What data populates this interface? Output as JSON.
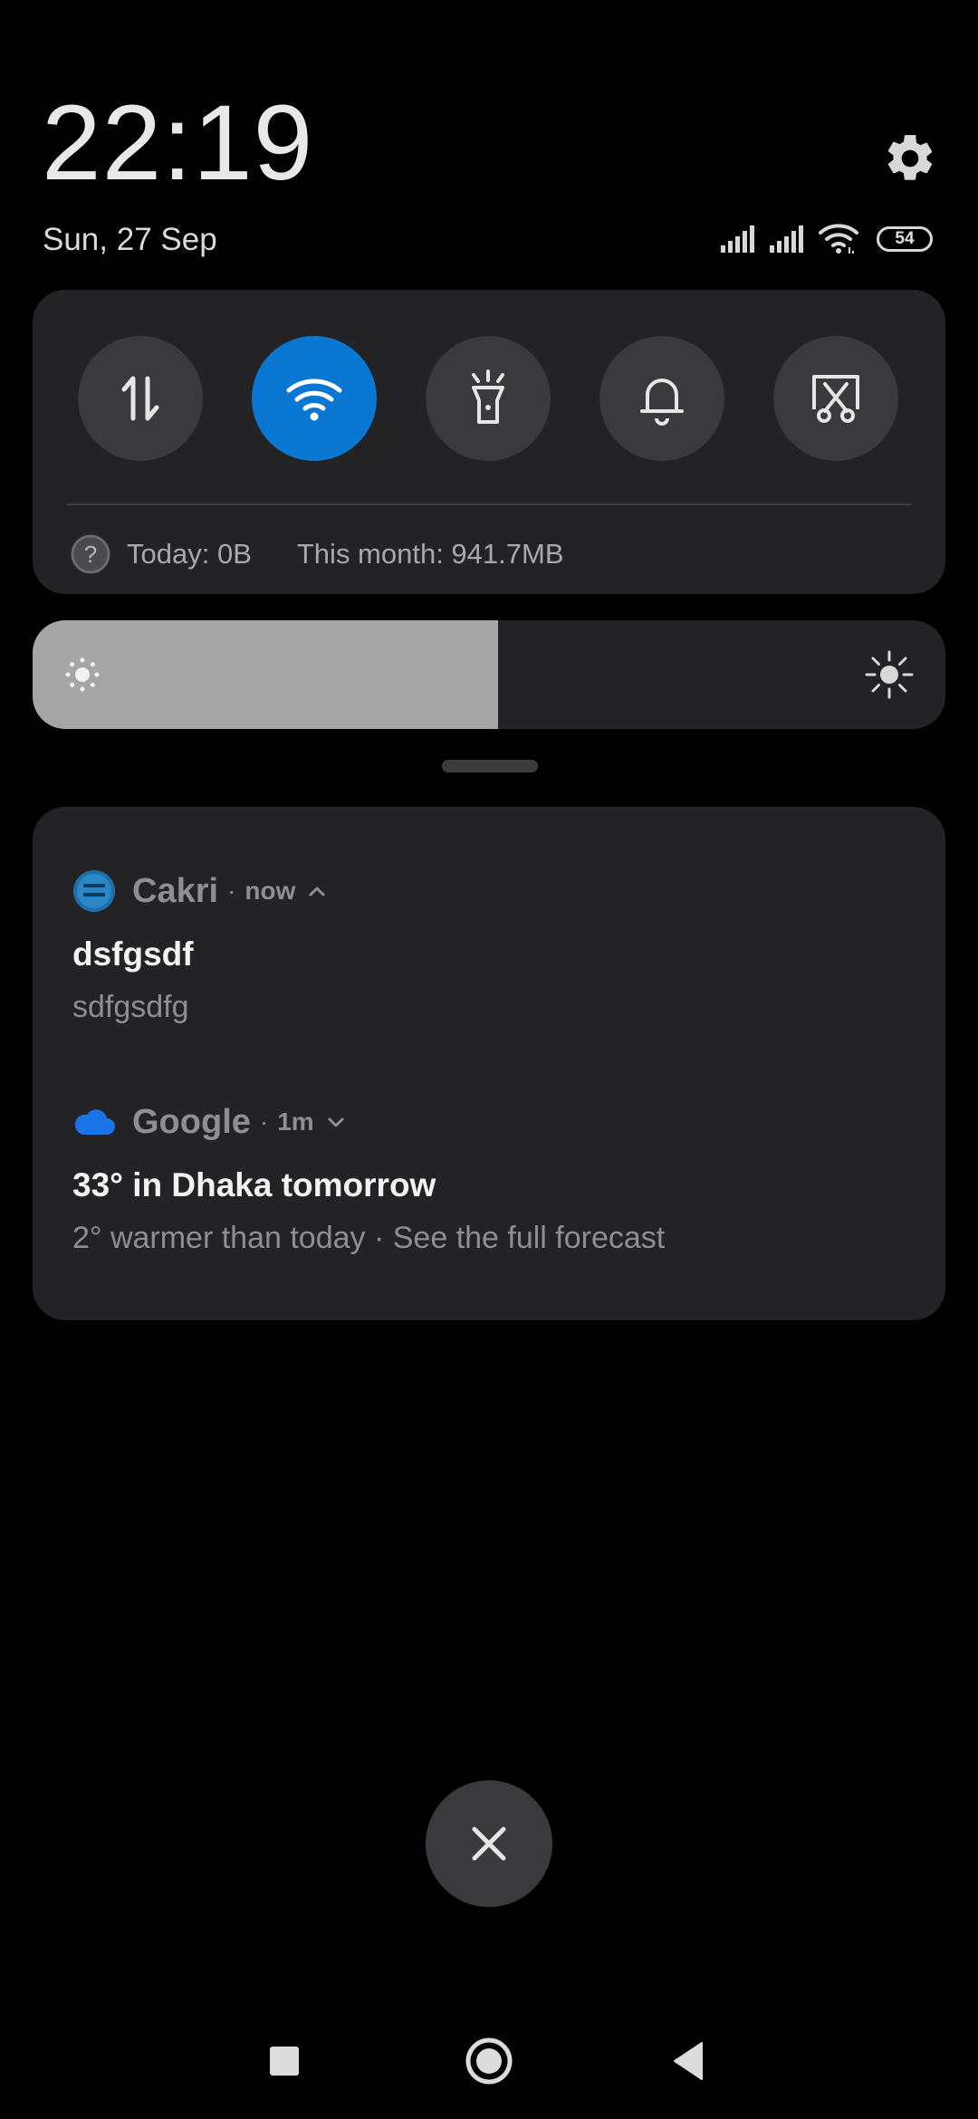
{
  "header": {
    "time": "22:19",
    "date": "Sun, 27 Sep",
    "battery_level": "54",
    "icons": [
      "gear-icon",
      "signal-sim1-icon",
      "signal-sim2-icon",
      "wifi-icon",
      "battery-icon"
    ]
  },
  "quick_settings": {
    "toggles": [
      {
        "name": "mobile-data",
        "icon": "data-arrows-icon",
        "active": false
      },
      {
        "name": "wifi",
        "icon": "wifi-icon",
        "active": true
      },
      {
        "name": "flashlight",
        "icon": "flashlight-icon",
        "active": false
      },
      {
        "name": "sound",
        "icon": "bell-icon",
        "active": false
      },
      {
        "name": "screenshot",
        "icon": "scissors-screenshot-icon",
        "active": false
      }
    ],
    "usage_today": "Today: 0B",
    "usage_month": "This month: 941.7MB"
  },
  "brightness": {
    "level": 0.51,
    "fill_color": "#a6a6a6"
  },
  "notifications": [
    {
      "app": "Cakri",
      "time": "now",
      "expanded": true,
      "title": "dsfgsdf",
      "text": "sdfgsdfg"
    },
    {
      "app": "Google",
      "time": "1m",
      "expanded": false,
      "title": "33° in Dhaka tomorrow",
      "text": "2° warmer than today · See the full forecast"
    }
  ],
  "colors": {
    "accent": "#0a78d2",
    "panel": "#232325",
    "button": "#3a3a3c",
    "background": "#000000"
  }
}
